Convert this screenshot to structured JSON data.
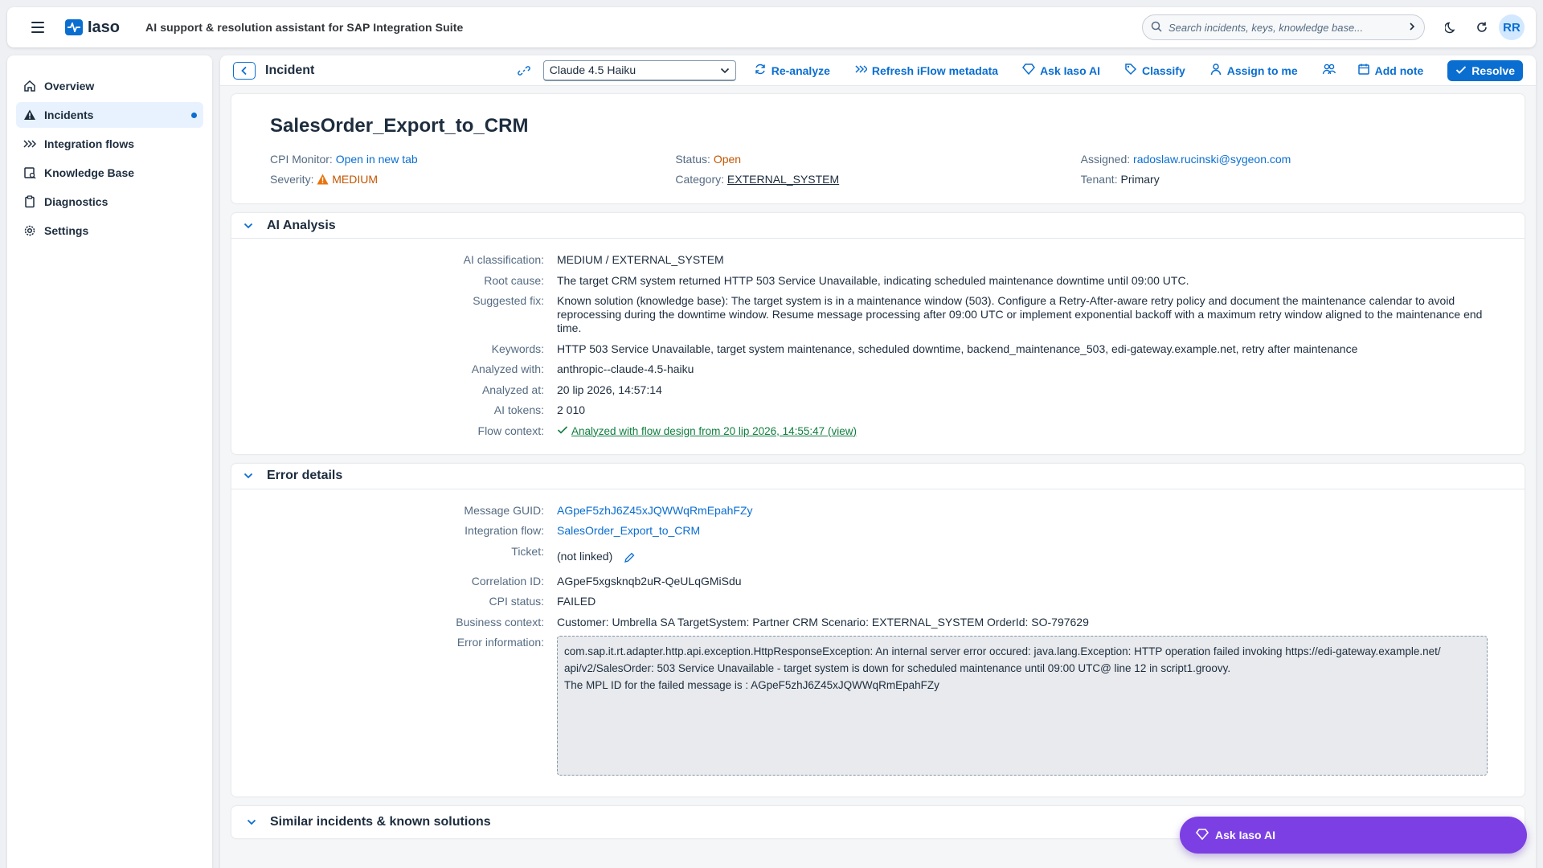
{
  "shell": {
    "logo_text": "Iaso",
    "subtitle": "AI support & resolution assistant for SAP Integration Suite",
    "search_placeholder": "Search incidents, keys, knowledge base...",
    "avatar_initials": "RR"
  },
  "sidebar": {
    "items": [
      {
        "label": "Overview",
        "icon": "home-icon"
      },
      {
        "label": "Incidents",
        "icon": "alert-icon",
        "active": true
      },
      {
        "label": "Integration flows",
        "icon": "flows-icon"
      },
      {
        "label": "Knowledge Base",
        "icon": "book-icon"
      },
      {
        "label": "Diagnostics",
        "icon": "clipboard-icon"
      },
      {
        "label": "Settings",
        "icon": "gear-icon"
      }
    ]
  },
  "toolbar": {
    "title": "Incident",
    "model": "Claude 4.5 Haiku",
    "reanalyze": "Re-analyze",
    "refresh": "Refresh iFlow metadata",
    "ask": "Ask Iaso AI",
    "classify": "Classify",
    "assign": "Assign to me",
    "add_note": "Add note",
    "resolve": "Resolve"
  },
  "header": {
    "title": "SalesOrder_Export_to_CRM",
    "cpi_monitor_label": "CPI Monitor:",
    "cpi_monitor_link": "Open in new tab",
    "severity_label": "Severity:",
    "severity_value": "MEDIUM",
    "status_label": "Status:",
    "status_value": "Open",
    "category_label": "Category:",
    "category_value": "EXTERNAL_SYSTEM",
    "assigned_label": "Assigned:",
    "assigned_value": "radoslaw.rucinski@sygeon.com",
    "tenant_label": "Tenant:",
    "tenant_value": "Primary"
  },
  "ai_analysis": {
    "title": "AI Analysis",
    "classification_label": "AI classification:",
    "classification": "MEDIUM / EXTERNAL_SYSTEM",
    "root_cause_label": "Root cause:",
    "root_cause": "The target CRM system returned HTTP 503 Service Unavailable, indicating scheduled maintenance downtime until 09:00 UTC.",
    "fix_label": "Suggested fix:",
    "fix": "Known solution (knowledge base): The target system is in a maintenance window (503). Configure a Retry-After-aware retry policy and document the maintenance calendar to avoid reprocessing during the downtime window. Resume message processing after 09:00 UTC or implement exponential backoff with a maximum retry window aligned to the maintenance end time.",
    "keywords_label": "Keywords:",
    "keywords": "HTTP 503 Service Unavailable, target system maintenance, scheduled downtime, backend_maintenance_503, edi-gateway.example.net, retry after maintenance",
    "analyzed_with_label": "Analyzed with:",
    "analyzed_with": "anthropic--claude-4.5-haiku",
    "analyzed_at_label": "Analyzed at:",
    "analyzed_at": "20 lip 2026, 14:57:14",
    "tokens_label": "AI tokens:",
    "tokens": "2 010",
    "flow_context_label": "Flow context:",
    "flow_context": "Analyzed with flow design from 20 lip 2026, 14:55:47 (view)"
  },
  "error_details": {
    "title": "Error details",
    "guid_label": "Message GUID:",
    "guid": "AGpeF5zhJ6Z45xJQWWqRmEpahFZy",
    "flow_label": "Integration flow:",
    "flow": "SalesOrder_Export_to_CRM",
    "ticket_label": "Ticket:",
    "ticket": "(not linked)",
    "correlation_label": "Correlation ID:",
    "correlation": "AGpeF5xgsknqb2uR-QeULqGMiSdu",
    "cpi_status_label": "CPI status:",
    "cpi_status": "FAILED",
    "business_label": "Business context:",
    "business": "Customer: Umbrella SA TargetSystem: Partner CRM Scenario: EXTERNAL_SYSTEM OrderId: SO-797629",
    "error_label": "Error information:",
    "error_line1": "com.sap.it.rt.adapter.http.api.exception.HttpResponseException: An internal server error occured: java.lang.Exception: HTTP operation failed invoking https://edi-gateway.example.net/",
    "error_line2": "api/v2/SalesOrder: 503 Service Unavailable - target system is down for scheduled maintenance until 09:00 UTC@ line 12 in script1.groovy.",
    "error_line3": "The MPL ID for the failed message is : AGpeF5zhJ6Z45xJQWWqRmEpahFZy"
  },
  "similar": {
    "title": "Similar incidents & known solutions"
  },
  "fab": {
    "label": "Ask Iaso AI"
  }
}
